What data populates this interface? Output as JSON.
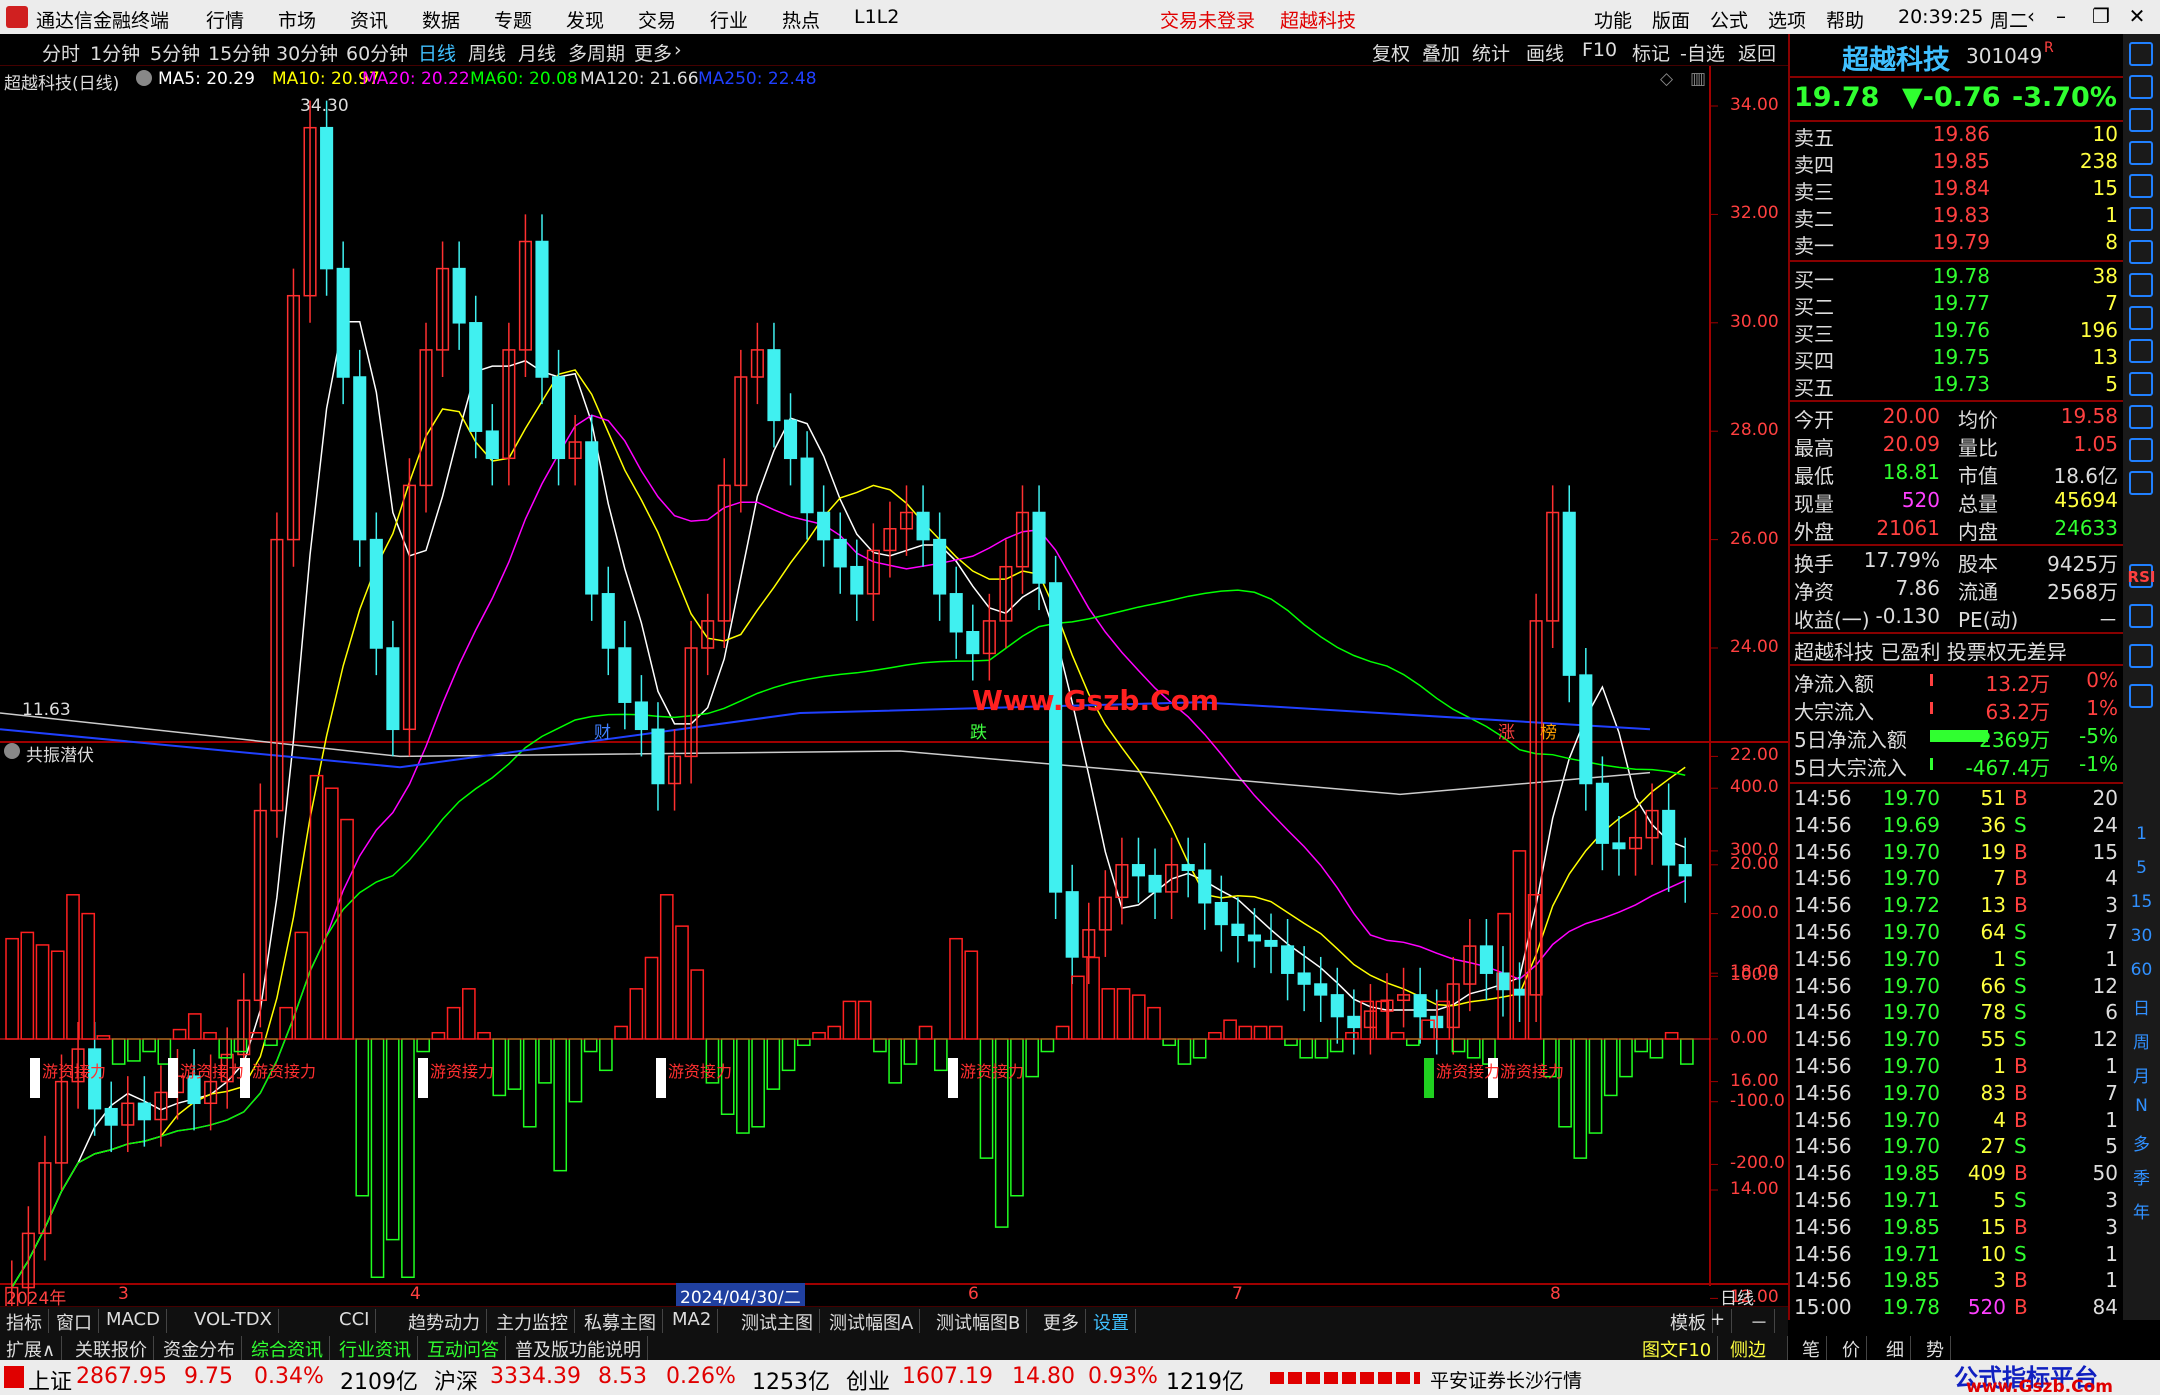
{
  "menubar": {
    "app_name": "通达信金融终端",
    "items": [
      "行情",
      "市场",
      "资讯",
      "数据",
      "专题",
      "发现",
      "交易",
      "行业",
      "热点",
      "L1L2"
    ],
    "trade_status": "交易未登录",
    "stock_name": "超越科技",
    "right_items": [
      "功能",
      "版面",
      "公式",
      "选项",
      "帮助"
    ],
    "clock": "20:39:25",
    "weekday": "周二"
  },
  "periods": [
    "分时",
    "1分钟",
    "5分钟",
    "15分钟",
    "30分钟",
    "60分钟",
    "日线",
    "周线",
    "月线",
    "多周期",
    "更多"
  ],
  "active_period": "日线",
  "tools": [
    "复权",
    "叠加",
    "统计",
    "画线",
    "F10",
    "标记",
    "-自选",
    "返回"
  ],
  "ma_legend": {
    "title": "超越科技(日线)",
    "items": [
      {
        "label": "MA5: 20.29",
        "color": "#ffffff"
      },
      {
        "label": "MA10: 20.97",
        "color": "#ffff00"
      },
      {
        "label": "MA20: 20.22",
        "color": "#ff00ff"
      },
      {
        "label": "MA60: 20.08",
        "color": "#00ff00"
      },
      {
        "label": "MA120: 21.66",
        "color": "#dddddd"
      },
      {
        "label": "MA250: 22.48",
        "color": "#2040ff"
      }
    ]
  },
  "price_axis": [
    "34.00",
    "32.00",
    "30.00",
    "28.00",
    "26.00",
    "24.00",
    "22.00",
    "20.00",
    "18.00",
    "16.00",
    "14.00",
    "12.00"
  ],
  "price_high_label": "34.30",
  "price_low_label": "11.63",
  "watermark": "Www.Gszb.Com",
  "event_markers": [
    {
      "label": "财",
      "color": "#4080ff"
    },
    {
      "label": "跌",
      "color": "#40ff40"
    },
    {
      "label": "涨",
      "color": "#ff4040"
    },
    {
      "label": "榜",
      "color": "#ffa000"
    }
  ],
  "indicator": {
    "title": "共振潜伏",
    "axis": [
      "400.0",
      "300.0",
      "200.0",
      "100.0",
      "0.00",
      "-100.0",
      "-200.0"
    ],
    "signal_labels": [
      "游资接力",
      "游资接力",
      "游资接力",
      "游资接力",
      "游资接力",
      "游资接力",
      "游资接力",
      "游资接力",
      "游资接力"
    ]
  },
  "date_axis": [
    "2024年",
    "3",
    "4",
    "2024/04/30/二",
    "6",
    "7",
    "8"
  ],
  "date_axis_right": "日线",
  "chart_data": {
    "type": "bar",
    "categories": [],
    "series": [
      {
        "values": [
          160,
          170,
          150,
          140,
          230,
          200,
          5,
          -40,
          -35,
          -20,
          -40,
          15,
          40,
          10,
          -30,
          -20,
          10,
          -10,
          50,
          170,
          420,
          400,
          350,
          -250,
          -380,
          -320,
          -380,
          -20,
          10,
          50,
          80,
          10,
          -90,
          -80,
          -140,
          -70,
          -210,
          -100,
          -20,
          -50,
          20,
          80,
          130,
          230,
          180,
          110,
          -70,
          -120,
          -150,
          -140,
          -80,
          -50,
          -10,
          10,
          20,
          60,
          60,
          -20,
          -70,
          -40,
          20,
          -50,
          160,
          140,
          -190,
          -300,
          -250,
          -60,
          -20,
          20,
          100,
          130,
          80,
          80,
          70,
          50,
          -10,
          -40,
          -30,
          10,
          30,
          20,
          20,
          20,
          -10,
          -30,
          -30,
          -20,
          10,
          60,
          60,
          10,
          -10,
          30,
          60,
          -20,
          -30,
          -40,
          200,
          300,
          230,
          -60,
          -140,
          -190,
          -150,
          -90,
          -60,
          -20,
          -30,
          10,
          -40
        ]
      }
    ]
  },
  "quote": {
    "name": "超越科技",
    "code": "301049",
    "price": "19.78",
    "change": "▼-0.76",
    "change_pct": "-3.70%",
    "asks": [
      {
        "label": "卖五",
        "price": "19.86",
        "vol": "10"
      },
      {
        "label": "卖四",
        "price": "19.85",
        "vol": "238"
      },
      {
        "label": "卖三",
        "price": "19.84",
        "vol": "15"
      },
      {
        "label": "卖二",
        "price": "19.83",
        "vol": "1"
      },
      {
        "label": "卖一",
        "price": "19.79",
        "vol": "8"
      }
    ],
    "bids": [
      {
        "label": "买一",
        "price": "19.78",
        "vol": "38"
      },
      {
        "label": "买二",
        "price": "19.77",
        "vol": "7"
      },
      {
        "label": "买三",
        "price": "19.76",
        "vol": "196"
      },
      {
        "label": "买四",
        "price": "19.75",
        "vol": "13"
      },
      {
        "label": "买五",
        "price": "19.73",
        "vol": "5"
      }
    ],
    "stats": [
      [
        "今开",
        "20.00",
        "均价",
        "19.58"
      ],
      [
        "最高",
        "20.09",
        "量比",
        "1.05"
      ],
      [
        "最低",
        "18.81",
        "市值",
        "18.6亿"
      ],
      [
        "现量",
        "520",
        "总量",
        "45694"
      ],
      [
        "外盘",
        "21061",
        "内盘",
        "24633"
      ]
    ],
    "stats2": [
      [
        "换手",
        "17.79%",
        "股本",
        "9425万"
      ],
      [
        "净资",
        "7.86",
        "流通",
        "2568万"
      ],
      [
        "收益(一)",
        "-0.130",
        "PE(动)",
        "－"
      ]
    ],
    "tagline": "超越科技 已盈利 投票权无差异",
    "flows": [
      [
        "净流入额",
        "13.2万",
        "0%"
      ],
      [
        "大宗流入",
        "63.2万",
        "1%"
      ],
      [
        "5日净流入额",
        "-2369万",
        "-5%"
      ],
      [
        "5日大宗流入",
        "-467.4万",
        "-1%"
      ]
    ],
    "ticks": [
      [
        "14:56",
        "19.70",
        "51",
        "B",
        "20"
      ],
      [
        "14:56",
        "19.69",
        "36",
        "S",
        "24"
      ],
      [
        "14:56",
        "19.70",
        "19",
        "B",
        "15"
      ],
      [
        "14:56",
        "19.70",
        "7",
        "B",
        "4"
      ],
      [
        "14:56",
        "19.72",
        "13",
        "B",
        "3"
      ],
      [
        "14:56",
        "19.70",
        "64",
        "S",
        "7"
      ],
      [
        "14:56",
        "19.70",
        "1",
        "S",
        "1"
      ],
      [
        "14:56",
        "19.70",
        "66",
        "S",
        "12"
      ],
      [
        "14:56",
        "19.70",
        "78",
        "S",
        "6"
      ],
      [
        "14:56",
        "19.70",
        "55",
        "S",
        "12"
      ],
      [
        "14:56",
        "19.70",
        "1",
        "B",
        "1"
      ],
      [
        "14:56",
        "19.70",
        "83",
        "B",
        "7"
      ],
      [
        "14:56",
        "19.70",
        "4",
        "B",
        "1"
      ],
      [
        "14:56",
        "19.70",
        "27",
        "S",
        "5"
      ],
      [
        "14:56",
        "19.85",
        "409",
        "B",
        "50"
      ],
      [
        "14:56",
        "19.71",
        "5",
        "S",
        "3"
      ],
      [
        "14:56",
        "19.85",
        "15",
        "B",
        "3"
      ],
      [
        "14:56",
        "19.71",
        "10",
        "S",
        "1"
      ],
      [
        "14:56",
        "19.85",
        "3",
        "B",
        "1"
      ],
      [
        "15:00",
        "19.78",
        "520",
        "B",
        "84"
      ]
    ]
  },
  "right_toolbar_text": [
    "RSI",
    "1",
    "5",
    "15",
    "30",
    "60",
    "日",
    "周",
    "月",
    "N",
    "多",
    "季",
    "年"
  ],
  "tabs1": [
    "指标",
    "窗口",
    "MACD",
    "VOL-TDX",
    "CCI",
    "趋势动力",
    "主力监控",
    "私募主图",
    "MA2",
    "测试主图",
    "测试幅图A",
    "测试幅图B",
    "更多",
    "设置"
  ],
  "tabs1_right": [
    "模板",
    "+",
    "－"
  ],
  "tabs2": [
    "扩展∧",
    "关联报价",
    "资金分布",
    "综合资讯",
    "行业资讯",
    "互动问答",
    "普及版功能说明"
  ],
  "tabs2_right": [
    "图文F10",
    "侧边栏《",
    "笔",
    "价",
    "细",
    "势"
  ],
  "statusbar": {
    "sh_label": "上证",
    "sh_val": "2867.95",
    "sh_chg": "9.75",
    "sh_pct": "0.34%",
    "sh_amt": "2109亿",
    "sz_label": "沪深",
    "sz_val": "3334.39",
    "sz_chg": "8.53",
    "sz_pct": "0.26%",
    "sz_amt": "1253亿",
    "cy_label": "创业",
    "cy_val": "1607.19",
    "cy_chg": "14.80",
    "cy_pct": "0.93%",
    "cy_amt": "1219亿",
    "broker": "平安证券长沙行情",
    "brand": "公式指标平台",
    "brand_url": "www.Gszb.Com"
  }
}
